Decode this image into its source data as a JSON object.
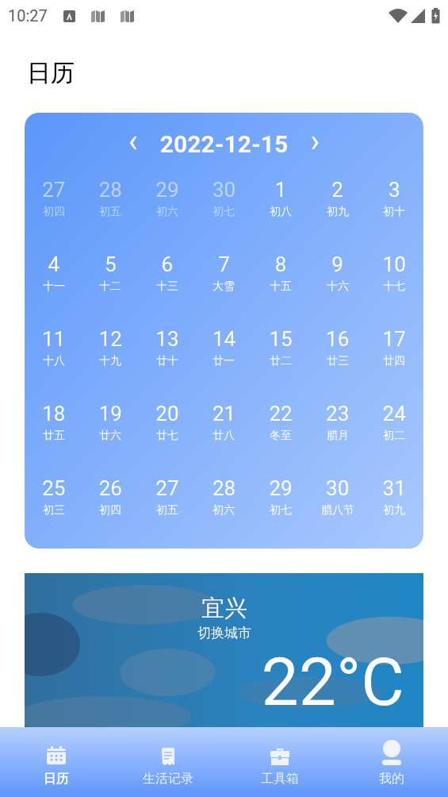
{
  "status_bar": {
    "time": "10:27"
  },
  "page_title": "日历",
  "calendar": {
    "date": "2022-12-15",
    "prev": "‹",
    "next": "›",
    "days": [
      {
        "day": "27",
        "lunar": "初四",
        "outside": true
      },
      {
        "day": "28",
        "lunar": "初五",
        "outside": true
      },
      {
        "day": "29",
        "lunar": "初六",
        "outside": true
      },
      {
        "day": "30",
        "lunar": "初七",
        "outside": true
      },
      {
        "day": "1",
        "lunar": "初八",
        "outside": false
      },
      {
        "day": "2",
        "lunar": "初九",
        "outside": false
      },
      {
        "day": "3",
        "lunar": "初十",
        "outside": false
      },
      {
        "day": "4",
        "lunar": "十一",
        "outside": false
      },
      {
        "day": "5",
        "lunar": "十二",
        "outside": false
      },
      {
        "day": "6",
        "lunar": "十三",
        "outside": false
      },
      {
        "day": "7",
        "lunar": "大雪",
        "outside": false
      },
      {
        "day": "8",
        "lunar": "十五",
        "outside": false
      },
      {
        "day": "9",
        "lunar": "十六",
        "outside": false
      },
      {
        "day": "10",
        "lunar": "十七",
        "outside": false
      },
      {
        "day": "11",
        "lunar": "十八",
        "outside": false
      },
      {
        "day": "12",
        "lunar": "十九",
        "outside": false
      },
      {
        "day": "13",
        "lunar": "廿十",
        "outside": false
      },
      {
        "day": "14",
        "lunar": "廿一",
        "outside": false
      },
      {
        "day": "15",
        "lunar": "廿二",
        "outside": false
      },
      {
        "day": "16",
        "lunar": "廿三",
        "outside": false
      },
      {
        "day": "17",
        "lunar": "廿四",
        "outside": false
      },
      {
        "day": "18",
        "lunar": "廿五",
        "outside": false
      },
      {
        "day": "19",
        "lunar": "廿六",
        "outside": false
      },
      {
        "day": "20",
        "lunar": "廿七",
        "outside": false
      },
      {
        "day": "21",
        "lunar": "廿八",
        "outside": false
      },
      {
        "day": "22",
        "lunar": "冬至",
        "outside": false
      },
      {
        "day": "23",
        "lunar": "腊月",
        "outside": false
      },
      {
        "day": "24",
        "lunar": "初二",
        "outside": false
      },
      {
        "day": "25",
        "lunar": "初三",
        "outside": false
      },
      {
        "day": "26",
        "lunar": "初四",
        "outside": false
      },
      {
        "day": "27",
        "lunar": "初五",
        "outside": false
      },
      {
        "day": "28",
        "lunar": "初六",
        "outside": false
      },
      {
        "day": "29",
        "lunar": "初七",
        "outside": false
      },
      {
        "day": "30",
        "lunar": "腊八节",
        "outside": false
      },
      {
        "day": "31",
        "lunar": "初九",
        "outside": false
      }
    ]
  },
  "weather": {
    "city": "宜兴",
    "switch_city": "切换城市",
    "temperature": "22°C"
  },
  "bottom_nav": [
    {
      "kind": "calendar",
      "label": "日历",
      "selected": true
    },
    {
      "kind": "notes",
      "label": "生活记录",
      "selected": false
    },
    {
      "kind": "toolbox",
      "label": "工具箱",
      "selected": false
    },
    {
      "kind": "profile",
      "label": "我的",
      "selected": false
    }
  ]
}
